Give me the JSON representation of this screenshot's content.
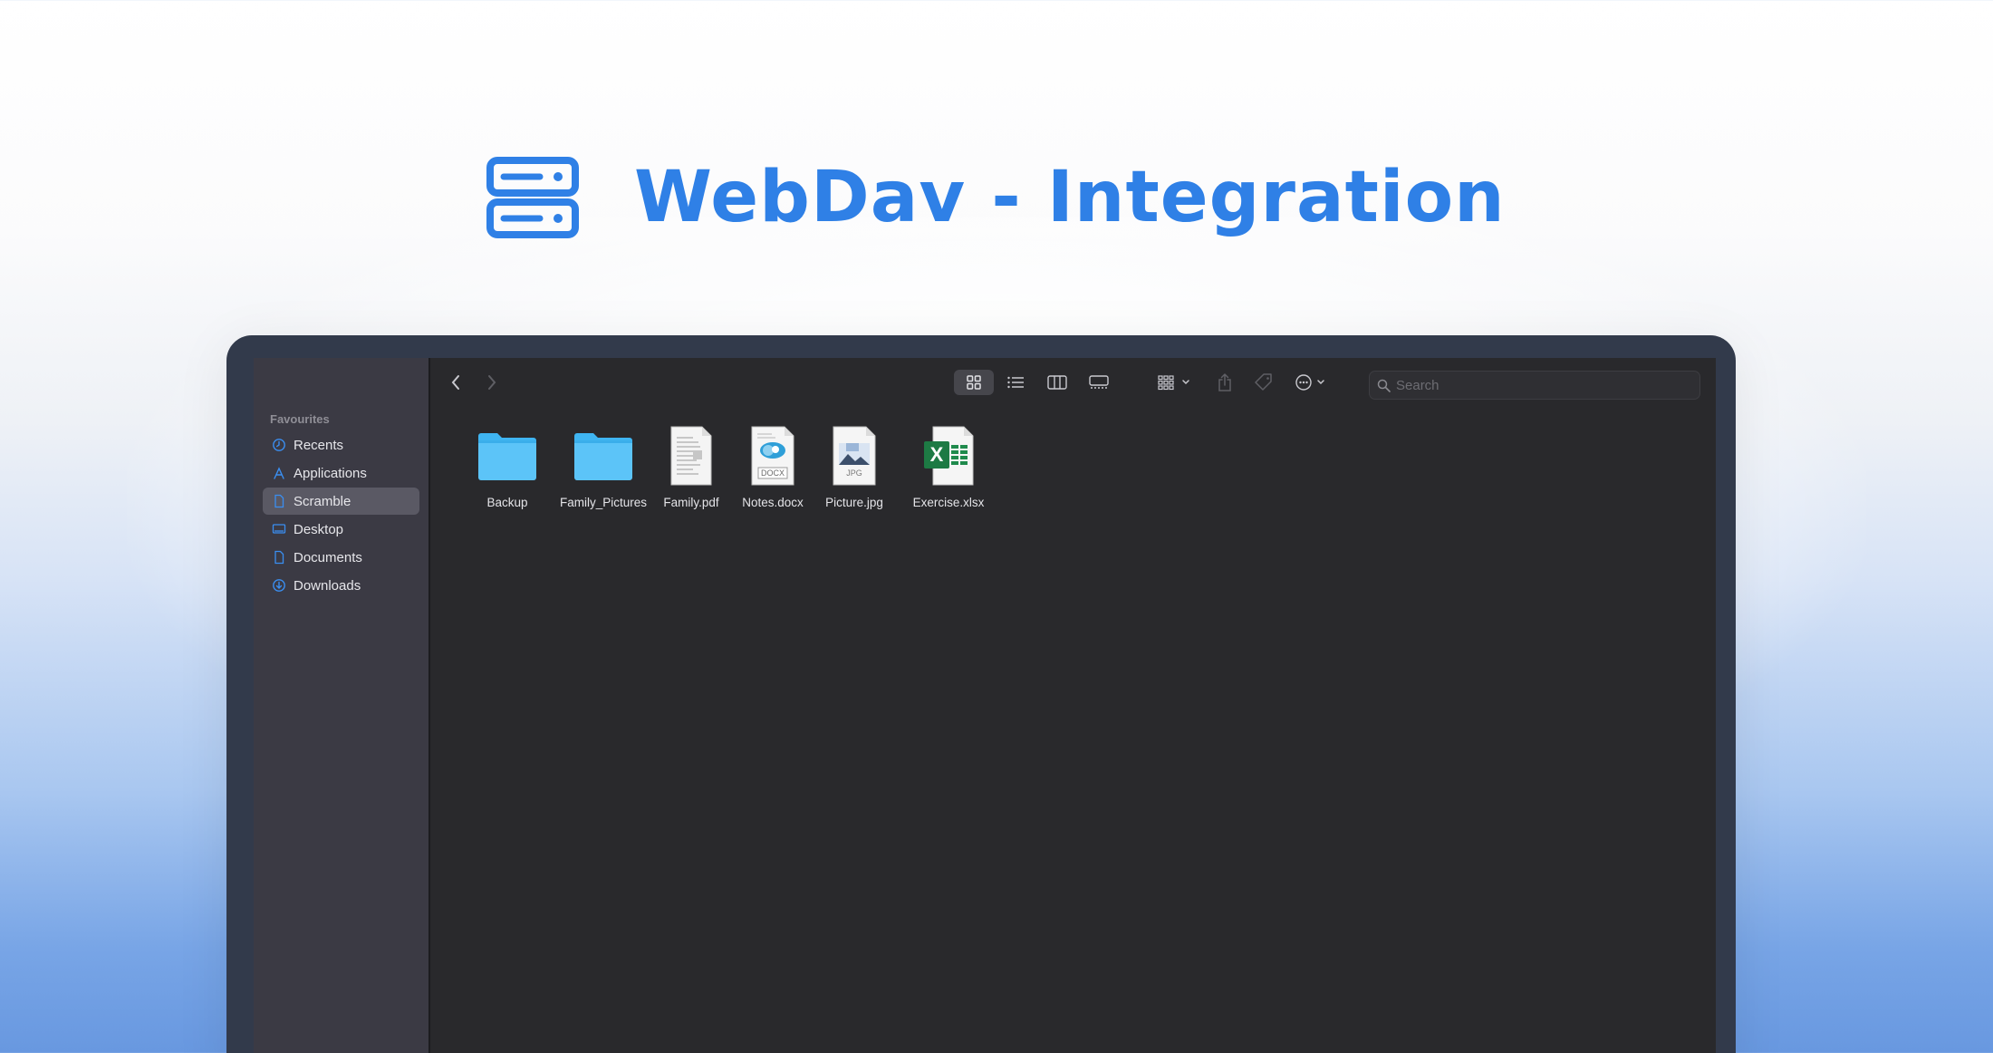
{
  "hero": {
    "title": "WebDav - Integration",
    "icon": "server-icon",
    "accent_color": "#2f80e6"
  },
  "window": {
    "sidebar": {
      "section_title": "Favourites",
      "items": [
        {
          "label": "Recents",
          "icon": "clock-icon",
          "active": false
        },
        {
          "label": "Applications",
          "icon": "applications-icon",
          "active": false
        },
        {
          "label": "Scramble",
          "icon": "document-icon",
          "active": true
        },
        {
          "label": "Desktop",
          "icon": "desktop-icon",
          "active": false
        },
        {
          "label": "Documents",
          "icon": "document-icon",
          "active": false
        },
        {
          "label": "Downloads",
          "icon": "download-icon",
          "active": false
        }
      ]
    },
    "toolbar": {
      "buttons": [
        "back-icon",
        "forward-icon",
        "icon-view-icon",
        "list-view-icon",
        "column-view-icon",
        "gallery-view-icon",
        "group-icon",
        "share-icon",
        "tag-icon",
        "more-actions-icon"
      ],
      "active_view": "icon-view",
      "search_placeholder": "Search"
    },
    "files": [
      {
        "name": "Backup",
        "type": "folder"
      },
      {
        "name": "Family_Pictures",
        "type": "folder"
      },
      {
        "name": "Family.pdf",
        "type": "pdf"
      },
      {
        "name": "Notes.docx",
        "type": "docx",
        "badge": "DOCX"
      },
      {
        "name": "Picture.jpg",
        "type": "jpg",
        "badge": "JPG"
      },
      {
        "name": "Exercise.xlsx",
        "type": "xlsx",
        "badge": "X"
      }
    ]
  }
}
